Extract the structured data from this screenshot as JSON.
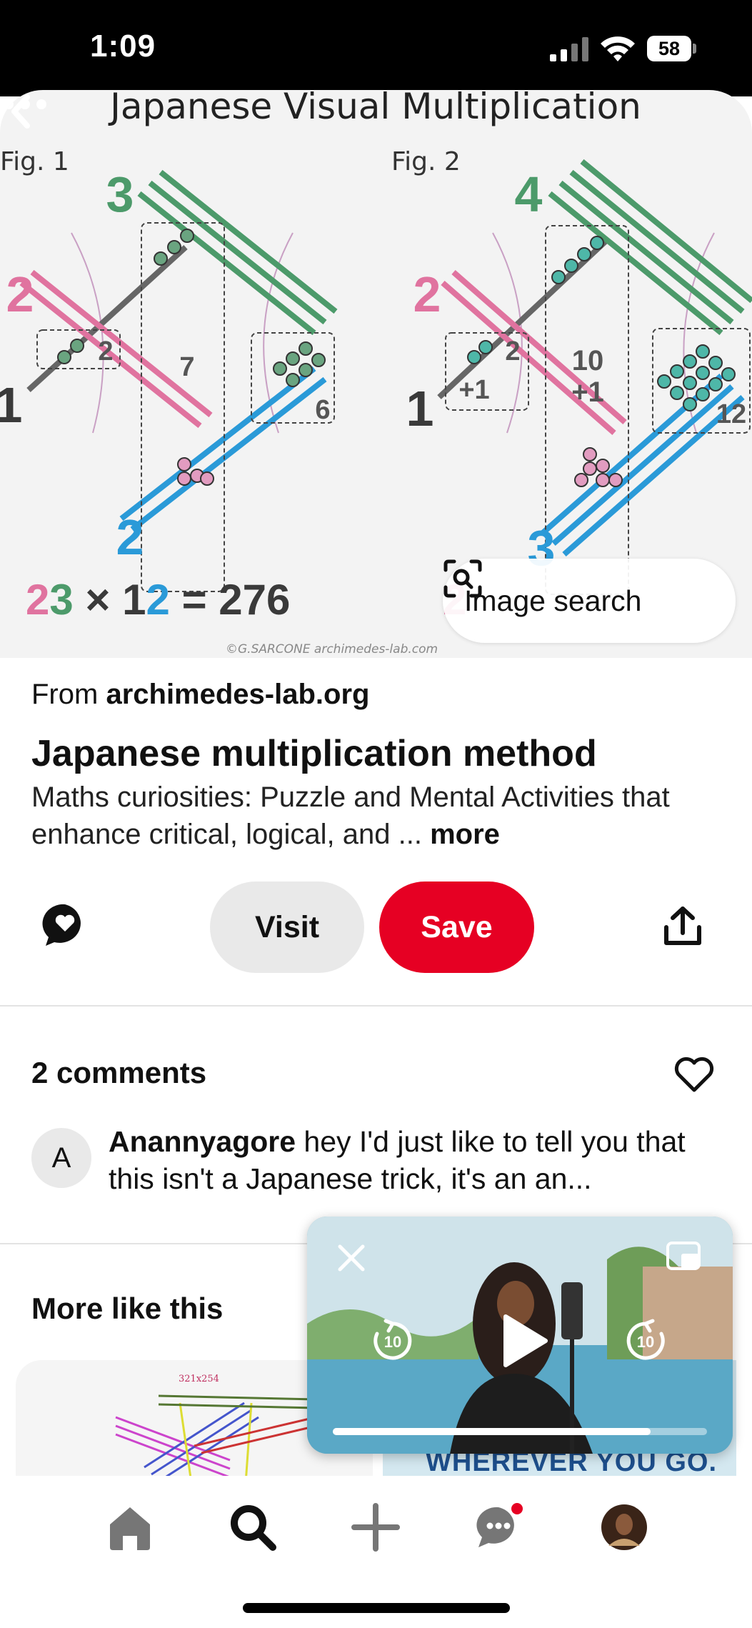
{
  "status_bar": {
    "time": "1:09",
    "battery": "58"
  },
  "pin_image": {
    "title": "Japanese Visual Multiplication",
    "fig1_label": "Fig. 1",
    "fig2_label": "Fig. 2",
    "fig1_top": "3",
    "fig1_left": "2",
    "fig1_edge": "1",
    "fig1_bottom": "2",
    "fig1_box_left": "2",
    "fig1_box_middle": "7",
    "fig1_box_right": "6",
    "fig2_top": "4",
    "fig2_left": "2",
    "fig2_edge": "1",
    "fig2_bottom": "3",
    "fig2_box_left_top": "2",
    "fig2_box_left_bottom": "+1",
    "fig2_box_middle_top": "10",
    "fig2_box_middle_bottom": "+1",
    "fig2_box_right": "12",
    "eq_a1": "2",
    "eq_a2": "3",
    "eq_times": "×",
    "eq_b1": "1",
    "eq_b2": "2",
    "eq_rest": "= 276",
    "eq2_partial": "2",
    "credit": "©G.SARCONE archimedes-lab.com",
    "image_search_label": "Image search"
  },
  "pin_info": {
    "source_prefix": "From",
    "source_domain": "archimedes-lab.org",
    "title": "Japanese multiplication method",
    "description": "Maths curiosities: Puzzle and Mental Activities that enhance critical, logical, and ...",
    "more_label": "more"
  },
  "actions": {
    "visit_label": "Visit",
    "save_label": "Save"
  },
  "comments": {
    "title": "2 comments",
    "first": {
      "avatar_initial": "A",
      "author": "Anannyagore",
      "text": "hey I'd just like to tell you that this isn't a Japanese trick, it's an an..."
    }
  },
  "more_like_this": {
    "title": "More like this",
    "left_thumb_caption": "321x254",
    "right_thumb_text": "WHEREVER YOU GO."
  },
  "video_pip": {
    "skip_seconds": "10",
    "progress": 0.85
  },
  "colors": {
    "save_red": "#e60023",
    "pink": "#e0739f",
    "green": "#4c9a6a",
    "blue": "#2a9ad8",
    "dark": "#3a3a3a"
  },
  "icons": {
    "back": "chevron-left-icon",
    "more": "ellipsis-icon",
    "image_search": "visual-search-icon",
    "comment": "speech-bubble-heart-icon",
    "share": "share-upload-icon",
    "like": "heart-outline-icon",
    "home": "home-icon",
    "search": "search-icon",
    "create": "plus-icon",
    "messages": "chat-bubble-icon",
    "profile": "avatar-icon"
  }
}
